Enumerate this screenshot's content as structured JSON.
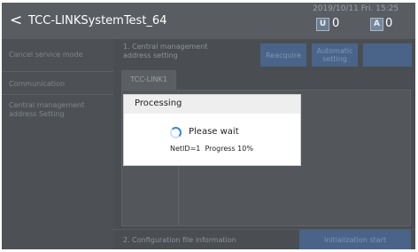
{
  "header": {
    "back_label": "<",
    "title": "TCC-LINKSystemTest_64",
    "datetime": "2019/10/11 Fri. 15:25",
    "badge1_count": "0",
    "badge2_count": "0"
  },
  "sidebar": {
    "items": [
      {
        "label": "Cancel service mode"
      },
      {
        "label": "Communication"
      },
      {
        "label": "Central management address Setting"
      }
    ]
  },
  "section1": {
    "title": "1. Central management address setting",
    "reacquire_label": "Reacquire",
    "automatic_label": "Automatic setting",
    "tab_label": "TCC-LINK1"
  },
  "section2": {
    "title": "2. Configuration file information",
    "init_label": "Initialization start"
  },
  "dialog": {
    "title": "Processing",
    "message": "Please wait",
    "net_id_label": "NetID=1",
    "progress_label": "Progress",
    "progress_value": "10%"
  },
  "colors": {
    "accent": "#3b84d9",
    "disabled_button": "#4a6489"
  }
}
